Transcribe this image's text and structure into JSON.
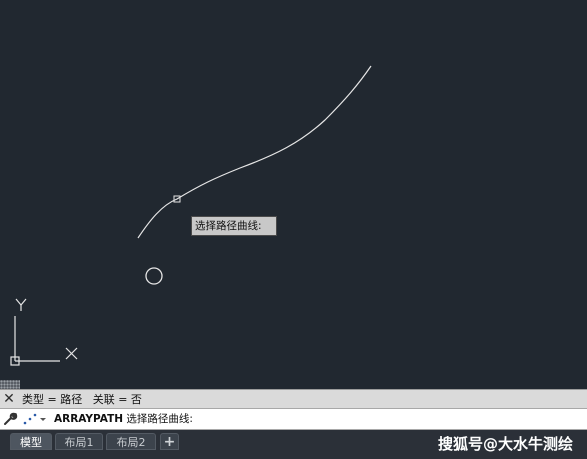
{
  "drawing": {
    "tooltip": "选择路径曲线:",
    "ucs_y": "Y",
    "ucs_x": "X"
  },
  "command": {
    "history": "类型 = 路径   关联 = 否",
    "command_name": "ARRAYPATH",
    "prompt": "选择路径曲线:",
    "close_glyph": "✕"
  },
  "tabs": [
    {
      "label": "模型",
      "active": true
    },
    {
      "label": "布局1",
      "active": false
    },
    {
      "label": "布局2",
      "active": false
    }
  ],
  "add_tab_glyph": "+",
  "watermark": "搜狐号@大水牛测绘",
  "colors": {
    "background": "#212830",
    "curve": "#e6e6e6",
    "tooltip_bg": "#c8c8c8"
  },
  "icons": [
    "close-icon",
    "wrench-icon",
    "command-prompt-icon",
    "crosshair-circle-icon",
    "ucs-icon"
  ]
}
